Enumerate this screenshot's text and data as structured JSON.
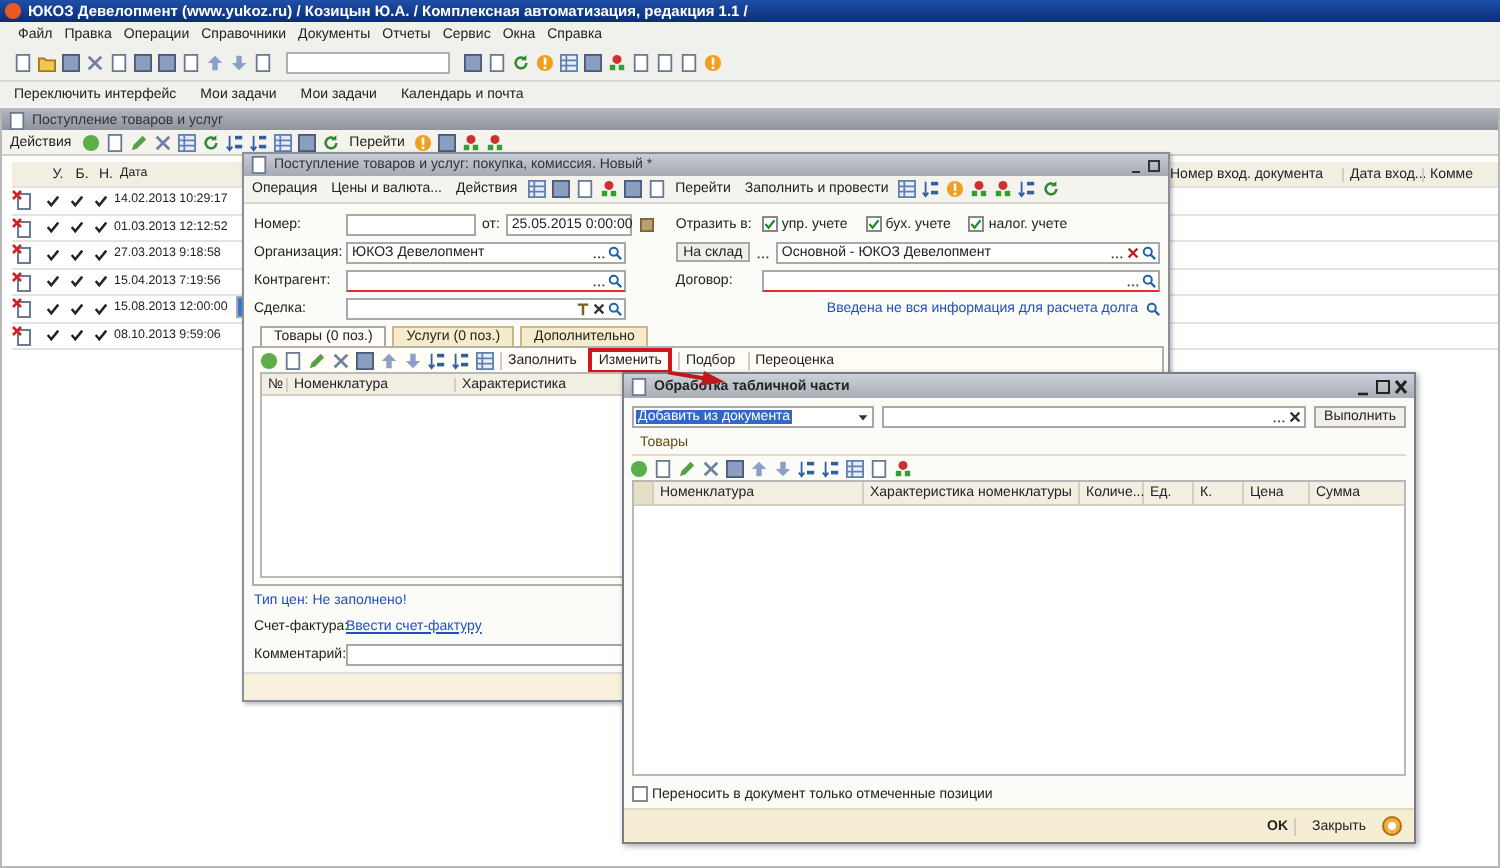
{
  "app_title": "ЮКОЗ Девелопмент (www.yukoz.ru) / Козицын Ю.А. / Комплексная автоматизация, редакция 1.1 /",
  "menu": [
    "Файл",
    "Правка",
    "Операции",
    "Справочники",
    "Документы",
    "Отчеты",
    "Сервис",
    "Окна",
    "Справка"
  ],
  "panel": [
    "Переключить интерфейс",
    "Мои задачи",
    "Мои задачи",
    "Календарь и почта"
  ],
  "list_window": {
    "title": "Поступление товаров и услуг",
    "actions": [
      "Действия",
      "Перейти"
    ],
    "columns": [
      "У.",
      "Б.",
      "Н.",
      "Дата"
    ],
    "right_columns": [
      "Номер вход. документа",
      "Дата вход...",
      "Комме"
    ],
    "rows": [
      {
        "u": true,
        "b": true,
        "n": true,
        "date": "14.02.2013 10:29:17",
        "selected": false
      },
      {
        "u": true,
        "b": true,
        "n": true,
        "date": "01.03.2013 12:12:52",
        "selected": false
      },
      {
        "u": true,
        "b": true,
        "n": true,
        "date": "27.03.2013 9:18:58",
        "selected": false
      },
      {
        "u": true,
        "b": true,
        "n": true,
        "date": "15.04.2013 7:19:56",
        "selected": false
      },
      {
        "u": true,
        "b": true,
        "n": true,
        "date": "15.08.2013 12:00:00",
        "selected": true
      },
      {
        "u": true,
        "b": true,
        "n": true,
        "date": "08.10.2013 9:59:06",
        "selected": false
      }
    ]
  },
  "document": {
    "title": "Поступление товаров и услуг: покупка, комиссия. Новый *",
    "toolbar": [
      "Операция",
      "Цены и валюта...",
      "Действия",
      "Перейти",
      "Заполнить и провести"
    ],
    "left_fields": [
      {
        "kind": "number",
        "label": "Номер:",
        "date_label": "от:",
        "date": "25.05.2015 0:00:00",
        "required": false
      },
      {
        "kind": "ref",
        "label": "Организация:",
        "value": "ЮКОЗ Девелопмент",
        "required": false
      },
      {
        "kind": "ref",
        "label": "Контрагент:",
        "required": true
      },
      {
        "kind": "deal",
        "label": "Сделка:",
        "required": false
      }
    ],
    "reflect": {
      "label": "Отразить в:",
      "options": [
        {
          "label": "упр. учете",
          "checked": true
        },
        {
          "label": "бух. учете",
          "checked": true
        },
        {
          "label": "налог. учете",
          "checked": true
        }
      ]
    },
    "warehouse": {
      "button": "На склад",
      "value": "Основной - ЮКОЗ Девелопмент"
    },
    "contract": {
      "label": "Договор:",
      "required": true
    },
    "debt_link": "Введена не вся информация для расчета долга",
    "tabs": [
      {
        "label": "Товары (0 поз.)",
        "selected": true
      },
      {
        "label": "Услуги (0 поз.)",
        "selected": false
      },
      {
        "label": "Дополнительно",
        "selected": false
      }
    ],
    "tab_buttons": [
      {
        "label": "Заполнить",
        "highlighted": false
      },
      {
        "label": "Изменить",
        "highlighted": true
      },
      {
        "label": "Подбор",
        "highlighted": false
      },
      {
        "label": "Переоценка",
        "highlighted": false
      }
    ],
    "columns": [
      "№",
      "Номенклатура",
      "Характеристика"
    ],
    "price_type": "Тип цен: Не заполнено!",
    "invoice_label": "Счет-фактура:",
    "invoice_link": "Ввести счет-фактуру",
    "comment_label": "Комментарий:"
  },
  "dialog": {
    "title": "Обработка табличной части",
    "action": "Добавить из документа",
    "run_button": "Выполнить",
    "section": "Товары",
    "columns": [
      "Номенклатура",
      "Характеристика номенклатуры",
      "Количе...",
      "Ед.",
      "К.",
      "Цена",
      "Сумма"
    ],
    "transfer": {
      "label": "Переносить в документ только отмеченные позиции",
      "checked": false
    },
    "buttons": [
      "OK",
      "Закрыть"
    ]
  }
}
